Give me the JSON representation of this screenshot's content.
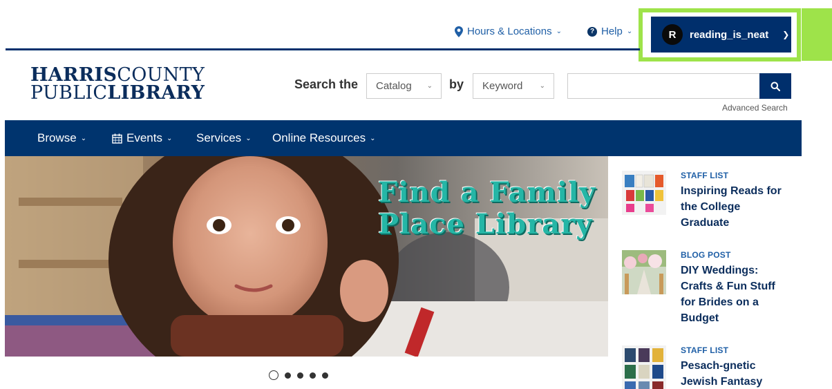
{
  "topbar": {
    "hours_label": "Hours & Locations",
    "help_label": "Help",
    "user": {
      "initial": "R",
      "name": "reading_is_neat"
    }
  },
  "logo": {
    "line1_bold": "HARRIS",
    "line1_thin": "COUNTY",
    "line2_thin": "PUBLIC",
    "line2_bold": "LIBRARY"
  },
  "search": {
    "label": "Search the",
    "scope_selected": "Catalog",
    "by_label": "by",
    "field_selected": "Keyword",
    "query_value": "",
    "advanced_label": "Advanced Search"
  },
  "nav": {
    "items": [
      {
        "label": "Browse"
      },
      {
        "label": "Events"
      },
      {
        "label": "Services"
      },
      {
        "label": "Online Resources"
      }
    ]
  },
  "hero": {
    "title_line1": "Find a Family",
    "title_line2": "Place Library",
    "slide_count": 5,
    "active_slide": 1
  },
  "sidebar": {
    "items": [
      {
        "category": "STAFF LIST",
        "title": "Inspiring Reads for the College Graduate"
      },
      {
        "category": "BLOG POST",
        "title": "DIY Weddings: Crafts & Fun Stuff for Brides on a Budget"
      },
      {
        "category": "STAFF LIST",
        "title": "Pesach-gnetic Jewish Fantasy"
      }
    ]
  },
  "colors": {
    "navy": "#002f6c",
    "link_blue": "#1f5fa6",
    "highlight_green": "#9ee34a",
    "hero_teal": "#25b6a6"
  }
}
